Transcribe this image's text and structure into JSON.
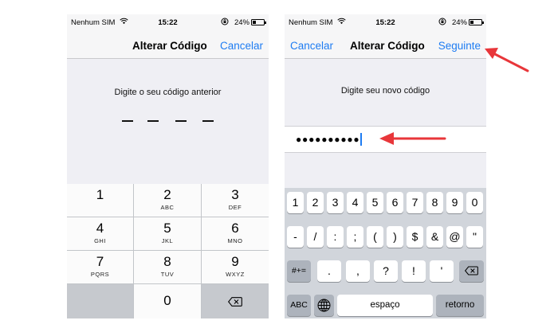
{
  "status_bar": {
    "carrier": "Nenhum SIM",
    "time": "15:22",
    "battery": "24%"
  },
  "left_screen": {
    "title": "Alterar Código",
    "cancel_label": "Cancelar",
    "prompt": "Digite o seu código anterior",
    "keypad": [
      {
        "digit": "1",
        "letters": ""
      },
      {
        "digit": "2",
        "letters": "ABC"
      },
      {
        "digit": "3",
        "letters": "DEF"
      },
      {
        "digit": "4",
        "letters": "GHI"
      },
      {
        "digit": "5",
        "letters": "JKL"
      },
      {
        "digit": "6",
        "letters": "MNO"
      },
      {
        "digit": "7",
        "letters": "PQRS"
      },
      {
        "digit": "8",
        "letters": "TUV"
      },
      {
        "digit": "9",
        "letters": "WXYZ"
      },
      {
        "digit": "0",
        "letters": ""
      }
    ],
    "delete_icon": "delete-backspace-icon"
  },
  "right_screen": {
    "cancel_label": "Cancelar",
    "title": "Alterar Código",
    "next_label": "Seguinte",
    "prompt": "Digite seu novo código",
    "password_dots": "●●●●●●●●●●",
    "keyboard_row1": [
      "1",
      "2",
      "3",
      "4",
      "5",
      "6",
      "7",
      "8",
      "9",
      "0"
    ],
    "keyboard_row2": [
      "-",
      "/",
      ":",
      ";",
      "(",
      ")",
      "$",
      "&",
      "@",
      "\""
    ],
    "keyboard_row3_left": "#+=",
    "keyboard_row3": [
      ".",
      ",",
      "?",
      "!",
      "'"
    ],
    "keyboard_bottom": {
      "abc": "ABC",
      "space": "espaço",
      "return": "retorno"
    },
    "globe_icon": "globe-icon",
    "delete_icon": "delete-backspace-icon"
  },
  "colors": {
    "accent": "#1e7cf2",
    "arrow": "#e8363a",
    "background": "#efeff4"
  }
}
